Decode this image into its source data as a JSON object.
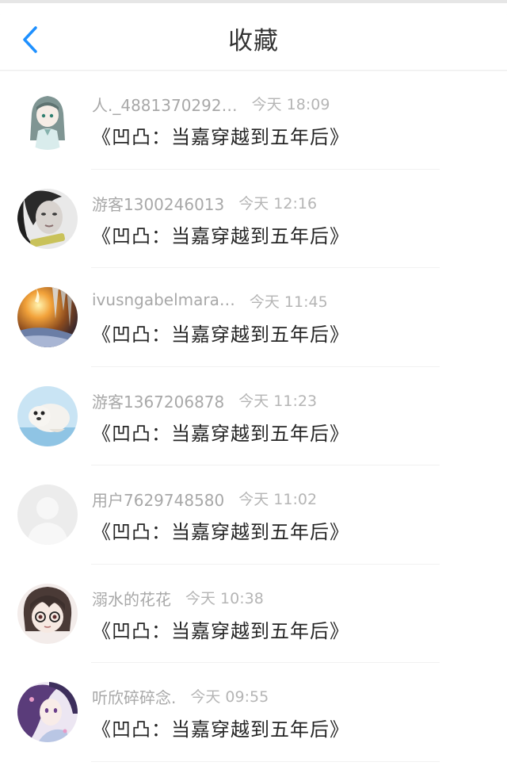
{
  "header": {
    "title": "收藏",
    "back_icon": "chevron-left-icon",
    "accent_color": "#1e90ff"
  },
  "favorites": [
    {
      "user": "人._4881370292…",
      "time": "今天 18:09",
      "book": "《凹凸：当嘉穿越到五年后》",
      "avatar": "anime-girl-avatar"
    },
    {
      "user": "游客1300246013",
      "time": "今天 12:16",
      "book": "《凹凸：当嘉穿越到五年后》",
      "avatar": "photo-girl-avatar"
    },
    {
      "user": "ivusngabelmara…",
      "time": "今天 11:45",
      "book": "《凹凸：当嘉穿越到五年后》",
      "avatar": "candle-ice-avatar"
    },
    {
      "user": "游客1367206878",
      "time": "今天 11:23",
      "book": "《凹凸：当嘉穿越到五年后》",
      "avatar": "seal-avatar"
    },
    {
      "user": "用户7629748580",
      "time": "今天 11:02",
      "book": "《凹凸：当嘉穿越到五年后》",
      "avatar": "default-avatar"
    },
    {
      "user": "溺水的花花",
      "time": "今天 10:38",
      "book": "《凹凸：当嘉穿越到五年后》",
      "avatar": "anime-glasses-avatar"
    },
    {
      "user": "听欣碎碎念.",
      "time": "今天 09:55",
      "book": "《凹凸：当嘉穿越到五年后》",
      "avatar": "anime-purple-avatar"
    }
  ]
}
